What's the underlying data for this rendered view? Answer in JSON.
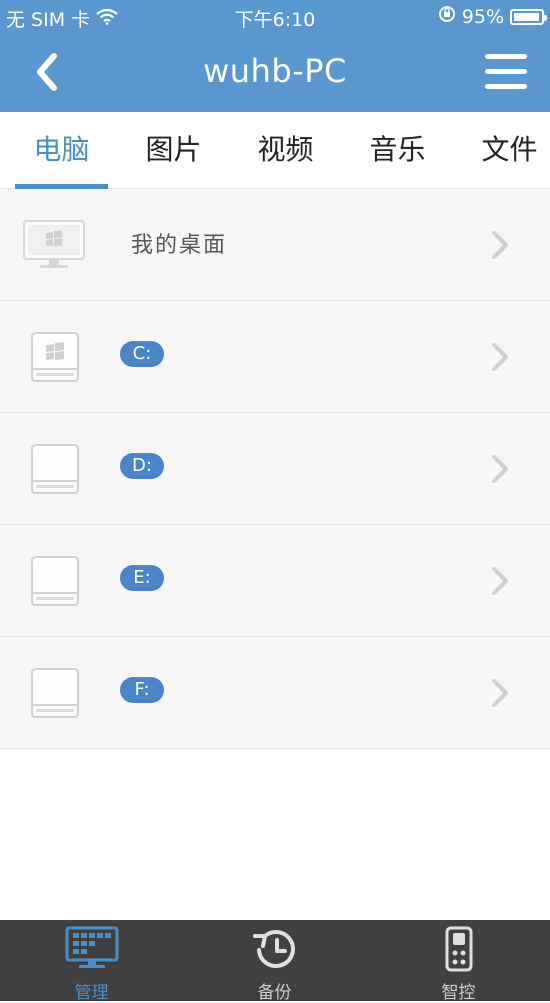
{
  "status_bar": {
    "carrier": "无 SIM 卡",
    "time": "下午6:10",
    "battery_percent": "95%",
    "battery_level": 0.95
  },
  "nav": {
    "title": "wuhb-PC",
    "back_icon": "chevron-left-icon",
    "menu_icon": "hamburger-menu-icon"
  },
  "tabs": [
    {
      "label": "电脑",
      "active": true
    },
    {
      "label": "图片",
      "active": false
    },
    {
      "label": "视频",
      "active": false
    },
    {
      "label": "音乐",
      "active": false
    },
    {
      "label": "文件",
      "active": false
    }
  ],
  "list": [
    {
      "type": "desktop",
      "label": "我的桌面",
      "icon": "monitor-windows-icon"
    },
    {
      "type": "drive",
      "label": "C:",
      "icon": "windows-drive-icon"
    },
    {
      "type": "drive",
      "label": "D:",
      "icon": "drive-icon"
    },
    {
      "type": "drive",
      "label": "E:",
      "icon": "drive-icon"
    },
    {
      "type": "drive",
      "label": "F:",
      "icon": "drive-icon"
    }
  ],
  "tabbar": [
    {
      "label": "管理",
      "icon": "monitor-grid-icon",
      "active": true
    },
    {
      "label": "备份",
      "icon": "backup-clock-icon",
      "active": false
    },
    {
      "label": "智控",
      "icon": "remote-control-icon",
      "active": false
    }
  ],
  "colors": {
    "header": "#5a98cf",
    "accent": "#4a8fca",
    "badge": "#4a86c7",
    "tabbar": "#404040"
  }
}
